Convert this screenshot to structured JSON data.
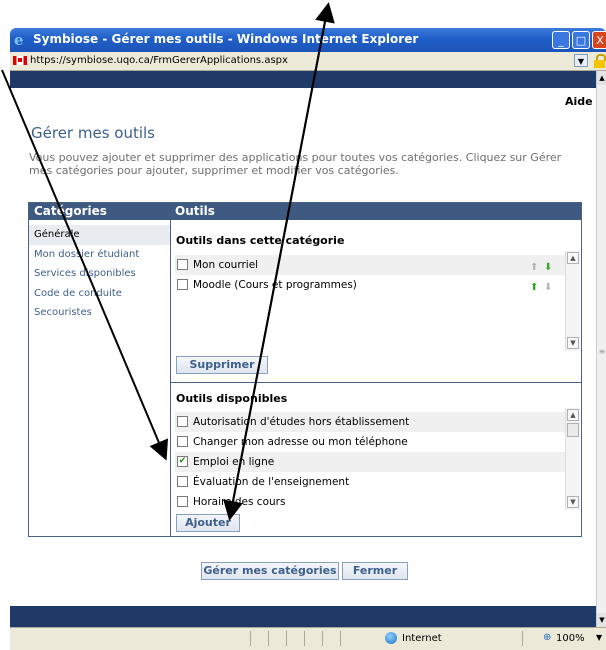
{
  "window": {
    "title": "Symbiose - Gérer mes outils - Windows Internet Explorer",
    "url": "https://symbiose.uqo.ca/FrmGererApplications.aspx",
    "min_glyph": "_",
    "max_glyph": "□",
    "close_glyph": "X"
  },
  "header": {
    "help": "Aide"
  },
  "page": {
    "title": "Gérer mes outils",
    "intro": "Vous pouvez ajouter et supprimer des applications pour toutes vos catégories. Cliquez sur Gérer mes catégories pour ajouter, supprimer et modifier vos catégories."
  },
  "categories": {
    "header": "Catégories",
    "items": [
      "Générale",
      "Mon dossier étudiant",
      "Services disponibles",
      "Code de conduite",
      "Secouristes"
    ],
    "selected": "Générale"
  },
  "tools": {
    "header": "Outils",
    "in_category_title": "Outils dans cette catégorie",
    "in_category": [
      {
        "label": "Mon courriel",
        "checked": false
      },
      {
        "label": "Moodle (Cours et programmes)",
        "checked": false
      }
    ],
    "remove_button": "Supprimer",
    "available_title": "Outils disponibles",
    "available": [
      {
        "label": "Autorisation d'études hors établissement",
        "checked": false
      },
      {
        "label": "Changer mon adresse ou mon téléphone",
        "checked": false
      },
      {
        "label": "Emploi en ligne",
        "checked": true
      },
      {
        "label": "Évaluation de l'enseignement",
        "checked": false
      },
      {
        "label": "Horaire des cours",
        "checked": false
      }
    ],
    "add_button": "Ajouter"
  },
  "footer": {
    "manage_categories_button": "Gérer mes catégories",
    "close_button": "Fermer"
  },
  "status": {
    "zone": "Internet",
    "zoom": "100%"
  },
  "colors": {
    "titlebar": "#1f5ec9",
    "navy": "#1f3a66",
    "panel_header": "#3f5a80",
    "link": "#3d5f8c"
  }
}
